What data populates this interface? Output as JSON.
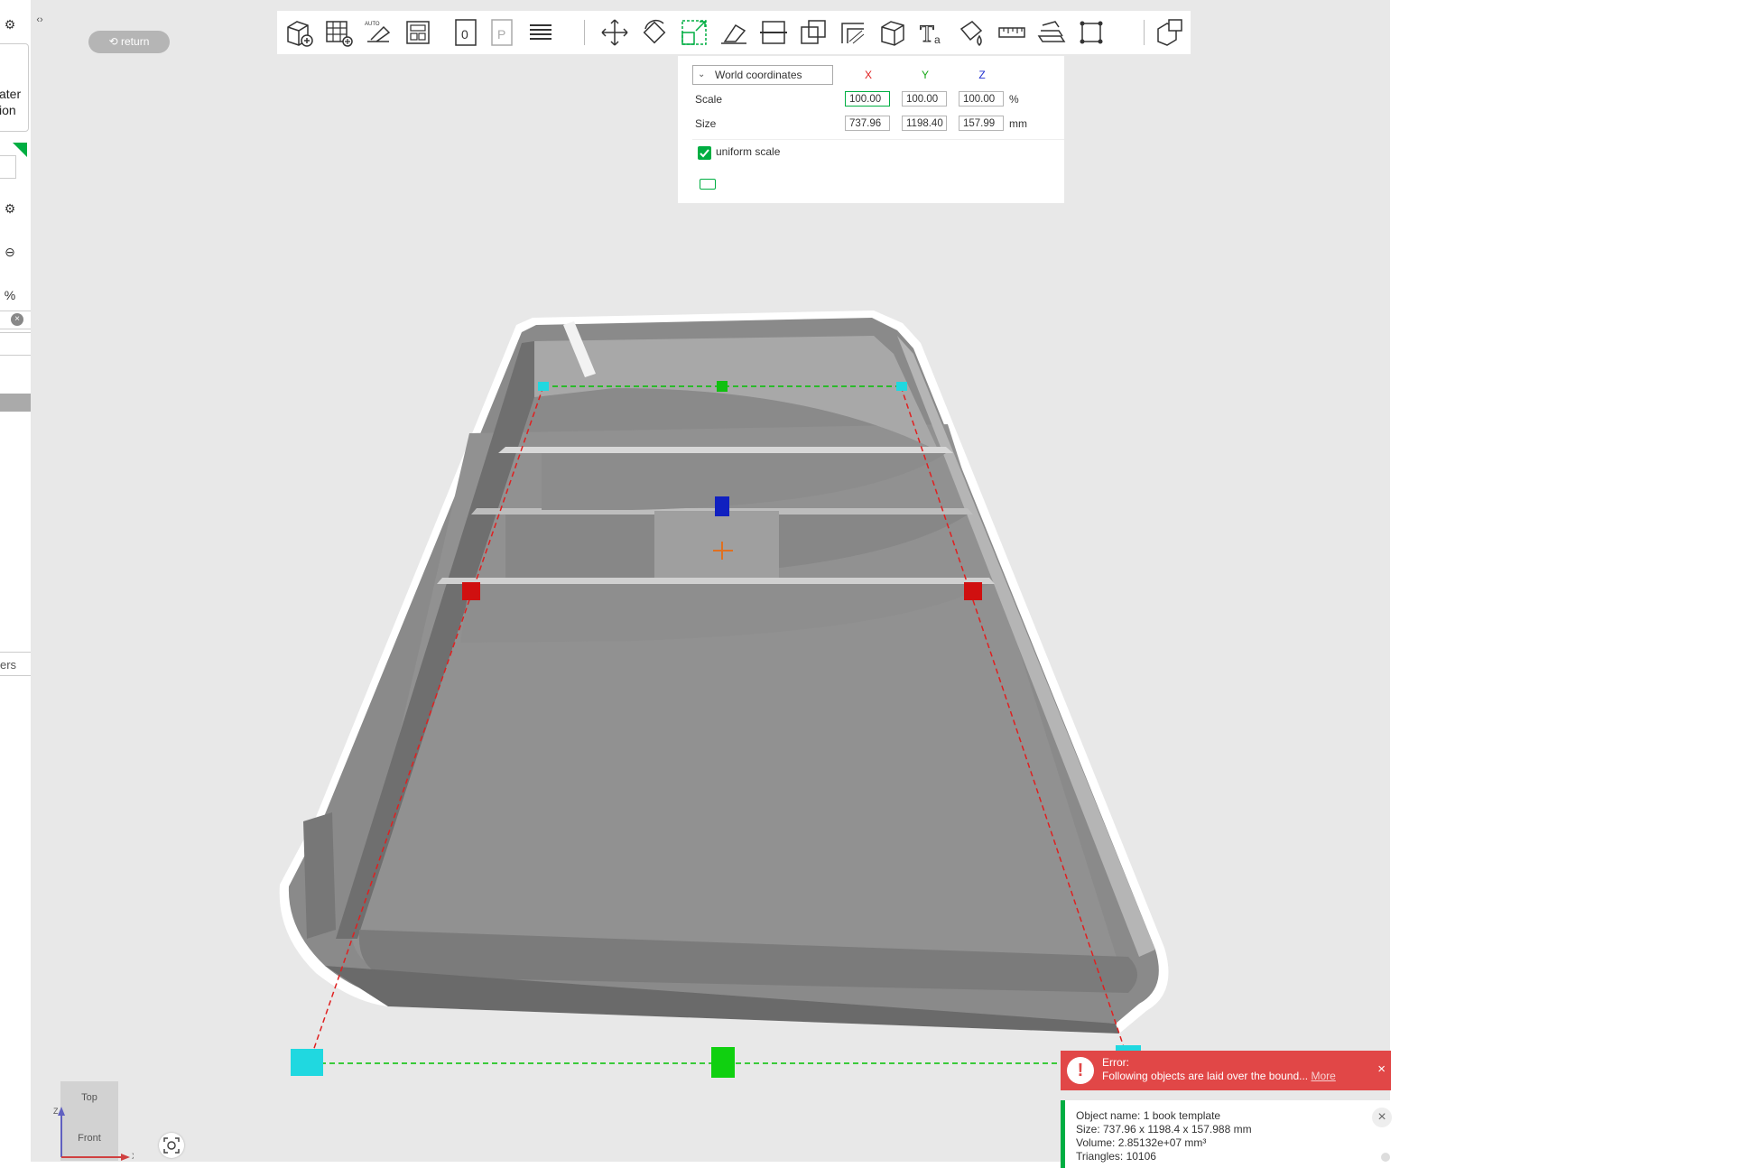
{
  "left_panel": {
    "fragment_1": "ater",
    "fragment_2": "ion",
    "fragment_3": "ers"
  },
  "return_button": "return",
  "toolbar": {
    "tools": [
      "add-part",
      "arrange",
      "auto-orient",
      "layout",
      "plate-0",
      "plate-p",
      "layers",
      "move",
      "rotate",
      "scale",
      "lay-on-face",
      "cut",
      "boolean",
      "support-paint",
      "seam-paint",
      "text",
      "fuzzy-skin",
      "measure",
      "assembly",
      "bounding-box",
      "split"
    ]
  },
  "scale_panel": {
    "coordinates": "World coordinates",
    "axes": {
      "x": "X",
      "y": "Y",
      "z": "Z"
    },
    "scale": {
      "label": "Scale",
      "x": "100.00",
      "y": "100.00",
      "z": "100.00",
      "unit": "%"
    },
    "size": {
      "label": "Size",
      "x": "737.96",
      "y": "1198.40",
      "z": "157.99",
      "unit": "mm"
    },
    "uniform_scale": "uniform scale",
    "colors": {
      "x": "#e02020",
      "y": "#18a818",
      "z": "#2030d0",
      "accent": "#00ae42"
    }
  },
  "view_cube": {
    "top": "Top",
    "front": "Front"
  },
  "axes_indicator": {
    "z": "Z",
    "x": "X"
  },
  "error": {
    "title": "Error:",
    "message": "Following objects are laid over the bound...",
    "more": "More"
  },
  "object_info": {
    "name": "Object name: 1 book template",
    "size": "Size: 737.96 x 1198.4 x 157.988 mm",
    "volume": "Volume: 2.85132e+07 mm³",
    "triangles": "Triangles: 10106"
  }
}
